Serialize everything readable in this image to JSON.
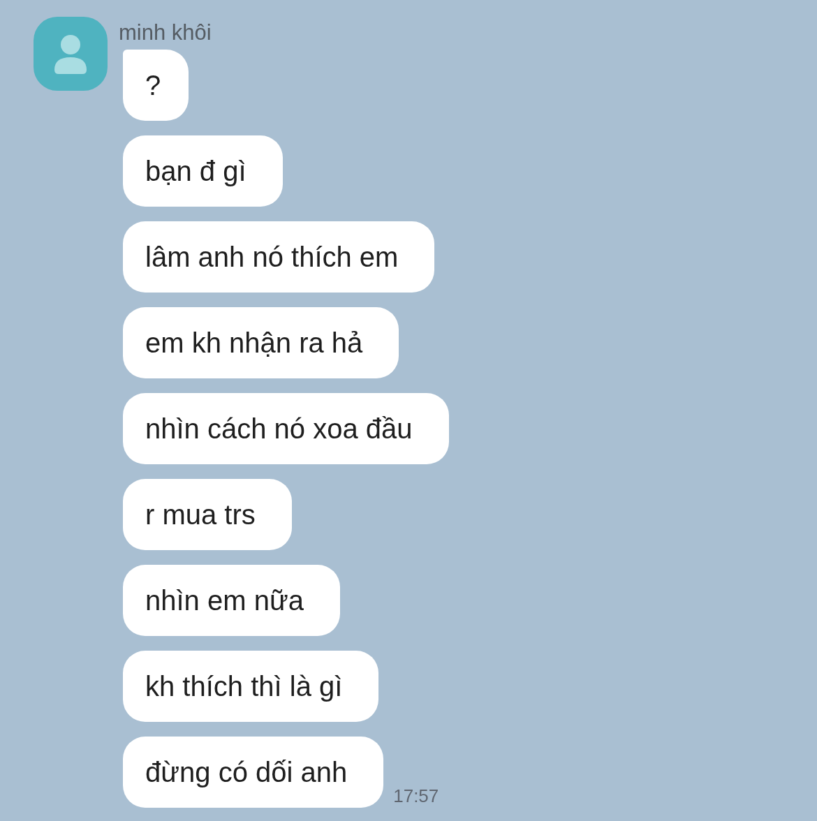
{
  "contact": {
    "name": "minh khôi"
  },
  "messages": [
    {
      "text": "?"
    },
    {
      "text": "bạn đ gì"
    },
    {
      "text": "lâm anh nó thích em"
    },
    {
      "text": "em kh nhận ra hả"
    },
    {
      "text": "nhìn cách nó xoa đầu"
    },
    {
      "text": "r mua trs"
    },
    {
      "text": "nhìn em nữa"
    },
    {
      "text": "kh thích thì là gì"
    },
    {
      "text": "đừng có dối anh"
    }
  ],
  "time": "17:57"
}
